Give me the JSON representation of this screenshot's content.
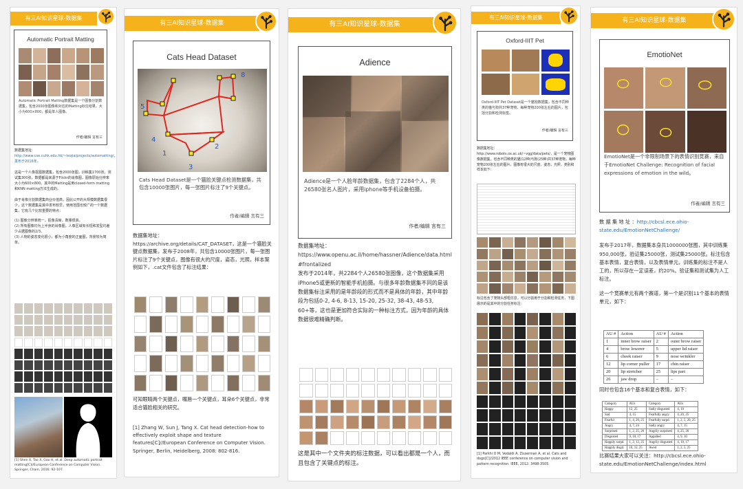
{
  "cards": {
    "c1": {
      "banner": "有三AI知识星球-数据集",
      "title": "Automatic Portrait Matting",
      "caption": "Automatic Portrait Matting数据集是一个图像分割数据集，包含2000张图像和对应的Matting标注结果，大小为600×800，都是单人图像。",
      "author": "作者/编辑 言有三",
      "addr_label": "数据集地址:",
      "addr_url": "http://www.cse.cuhk.edu.hk/~leojia/projects/automatting/",
      "addr_tail": "，发布于2016年。",
      "p1": "这是一个人像抠图数据集，包含2000张图，训练集1700张，测试集300张，数据都是来源于Flickr的肖像图，图像原始分辨率大小为600×800。其中的Matting是用closed-form matting和KNN matting方法生成的。",
      "p2": "由于肖像分割数据集商业价值高，因此公开的大规模数据集很少，这个数据集是其中发布较早，使用范围也较广的一个数据集，它有几个比较重要的特点：",
      "p3": "(1) 图像分辨率统一，抠像清晰，数量很高。",
      "p4": "(2) 所有图像均为上半身的肖像图，人像区域有长短和发型均差少占据图像的2/3。",
      "p5": "(3) 人物的姿态变化很小，都为小角度的正面图，背景较为简单。",
      "ref": "[1] Shen X, Tao X, Gao H, et al. Deep automatic portrait matting[C]//European Conference on Computer Vision. Springer, Cham, 2016: 92-107."
    },
    "c2": {
      "banner": "有三AI知识星球-数据集",
      "title": "Cats Head Dataset",
      "caption": "Cats Head Dataset是一个猫脸关键点检测数据集，共包含10000张图片，每一张图片标注了9个关键点。",
      "author": "作者/编辑 言有三",
      "addr_label": "数据集地址：",
      "addr_body": "https://archive.org/details/CAT_DATASET，这是一个猫脸关键点数据集，发布于2008年，共包含10000张图片，每一张图片标注了9个关键点，图像有很大的尺度，姿态，光照，样本案例如下，.cat文件包含了标注结果：",
      "after": "可知眼睛两个关键点，嘴唇一个关键点，耳朵6个关键点，非常适合猫脸相关的研究。",
      "ref": "[1] Zhang W, Sun J, Tang X. Cat head detection-how to effectively exploit shape and texture features[C]//European Conference on Computer Vision. Springer, Berlin, Heidelberg, 2008: 802-816.",
      "keypoints": [
        "1",
        "2",
        "3",
        "4",
        "5",
        "8"
      ]
    },
    "c3": {
      "banner": "有三AI知识星球-数据集",
      "title": "Adience",
      "caption": "Adience是一个人脸年龄数据集，包含了2284个人，共26580张名人图片，采用iphone等手机设备拍摄。",
      "author": "作者/编辑 言有三",
      "addr_label": "数据集地址：",
      "addr_url": "https://www.openu.ac.il/home/hassner/Adience/data.html#frontalized",
      "body": "发布于2014年，共2284个人26580张图像，这个数据集采用iPhone5或更新的智能手机拍摄。与很多年龄数据集不同的是该数据集标注采用的是年龄段的形式而不是具体的年龄，其中年龄段为包括0-2, 4-6, 8-13, 15-20, 25-32, 38-43, 48-53, 60+等，这也是更加符合实际的一种标注方式，因为年龄的具体数据很难精确判断。",
      "after": "这是其中一个文件夹的标注数据，可以看出都是一个人，而且包含了关键点的标注。"
    },
    "c4": {
      "banner": "有三AI知识星球-数据集",
      "title": "Oxford-IIIT Pet",
      "caption": "Oxford-IIIT Pet Dataset是一个猫狗数据集，包含不同种类的猫与狗共37种宠物，每种宠物200张左右的图片，包括分割和检测标签。",
      "author": "作者/编辑 言有三",
      "addr_label": "数据集地址：",
      "addr_body": "http://www.robots.ox.ac.uk/~vgg/data/pets/，是一个宠物图像数据集，包含不同种类的猫(12种)与狗(25种)共37种宠物，每种宠物200张左右的图片，图像有很大的尺度，姿态，光照，类别和样本如下：",
      "mid": "标注包含了宠物头部框信息，可以分割用于分割和检测任务，下图展示的是其中的分割任务标注：",
      "ref": "[1] Parkhi O M, Vedaldi A, Zisserman A, et al. Cats and dogs[C]//2012 IEEE conference on computer vision and pattern recognition. IEEE, 2012: 3498-3505."
    },
    "c5": {
      "banner": "有三AI知识星球-数据集",
      "title": "EmotioNet",
      "caption": "EmotioNet是一个非限制场景下的表情识别竞赛，来自于EmotioNet Challenge: Recognition of facial expressions of emotion in the wild。",
      "author": "作者/编辑 言有三",
      "addr_label": "数 据 集 地 址 ：",
      "addr_url": "http://cbcsl.ece.ohio-state.edu/EmotionNetChallenge/",
      "p1": "发布于2017年，数据集本身共1000000张图，其中训练集950,000张，验证集25000张，测试集25000张。标注包含基本表情，复合表情，以及表情单元，训练集的标注不是人工的，所以存在一定误差，约20%。验证集和测试集为人工标注。",
      "p2": "这一个竞赛单元有两个赛道，第一个是识别11个基本的表情单元，如下：",
      "p3": "同时也包含16个基本和复合表情，如下：",
      "follow": "比赛结果大家可以关注：http://cbcsl.ece.ohio-state.edu/EmotionNetChallenge/index.html",
      "au_header": [
        "AU #",
        "Action",
        "AU #",
        "Action"
      ],
      "au_rows": [
        [
          "1",
          "inner brow raiser",
          "2",
          "outer brow raiser"
        ],
        [
          "4",
          "brow lowerer",
          "5",
          "upper lid raiser"
        ],
        [
          "6",
          "cheek raiser",
          "9",
          "nose wrinkler"
        ],
        [
          "12",
          "lip corner puller",
          "17",
          "chin raiser"
        ],
        [
          "20",
          "lip stretcher",
          "25",
          "lips part"
        ],
        [
          "26",
          "jaw drop",
          "–",
          "–"
        ]
      ],
      "cat_header": [
        "Category",
        "AUs",
        "Category",
        "AUs"
      ],
      "cat_rows": [
        [
          "Happy",
          "12, 25",
          "Sadly disgusted",
          "4, 10"
        ],
        [
          "Sad",
          "4, 15",
          "Fearfully angry",
          "4, 20, 25"
        ],
        [
          "Fearful",
          "1, 4, 20, 25",
          "Fearfully surpd.",
          "1, 2, 5, 20, 25"
        ],
        [
          "Angry",
          "4, 7, 24",
          "Sadly angry",
          "4, 7, 15"
        ],
        [
          "Surprised",
          "1, 2, 25, 26",
          "Angrily surprised",
          "4, 25, 26"
        ],
        [
          "Disgusted",
          "9, 10, 17",
          "Appalled",
          "4, 9, 10"
        ],
        [
          "Happily surpd.",
          "1, 2, 12, 25",
          "Angrily disgusted",
          "4, 10, 17"
        ],
        [
          "Happily disgd.",
          "10, 12, 25",
          "Awed",
          "1, 2, 5, 25"
        ]
      ]
    }
  },
  "colors": {
    "banner": "#f6b21a",
    "link": "#2a6fb0",
    "keypoint": "#e0261d",
    "keypoint_label": "#1a56d6"
  }
}
